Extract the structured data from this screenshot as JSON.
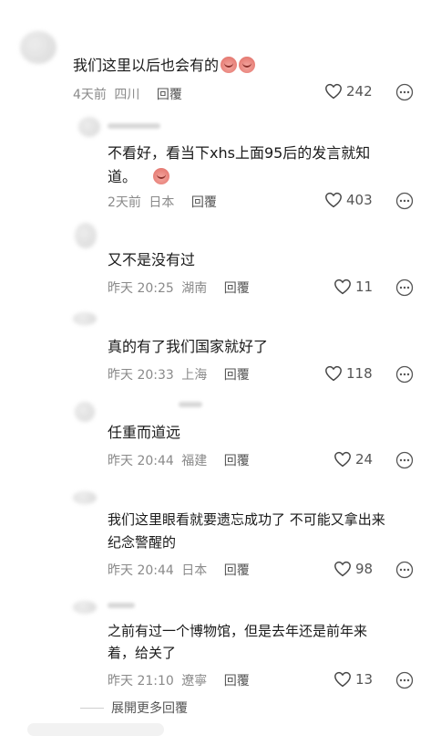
{
  "comments": [
    {
      "text": "我们这里以后也会有的",
      "emoji_count": 2,
      "date": "4天前",
      "location": "四川",
      "reply": "回覆",
      "likes": "242"
    },
    {
      "text_line1": "不看好，看当下xhs上面95后的发言就知",
      "text_line2": "道。",
      "emoji_count": 1,
      "date": "2天前",
      "location": "日本",
      "reply": "回覆",
      "likes": "403"
    },
    {
      "text": "又不是没有过",
      "date": "昨天 20:25",
      "location": "湖南",
      "reply": "回覆",
      "likes": "11"
    },
    {
      "text": "真的有了我们国家就好了",
      "date": "昨天 20:33",
      "location": "上海",
      "reply": "回覆",
      "likes": "118"
    },
    {
      "text": "任重而道远",
      "date": "昨天 20:44",
      "location": "福建",
      "reply": "回覆",
      "likes": "24"
    },
    {
      "text_line1": "我们这里眼看就要遗忘成功了 不可能又拿出来",
      "text_line2": "纪念警醒的",
      "date": "昨天 20:44",
      "location": "日本",
      "reply": "回覆",
      "likes": "98"
    },
    {
      "text_line1": "之前有过一个博物馆，但是去年还是前年来",
      "text_line2": "着，给关了",
      "date": "昨天 21:10",
      "location": "遼寧",
      "reply": "回覆",
      "likes": "13"
    }
  ],
  "expand_label": "展開更多回覆",
  "icons": {
    "like": "heart-outline-icon",
    "more": "more-dots-icon",
    "emoji": "crying-face-emoji-icon"
  }
}
